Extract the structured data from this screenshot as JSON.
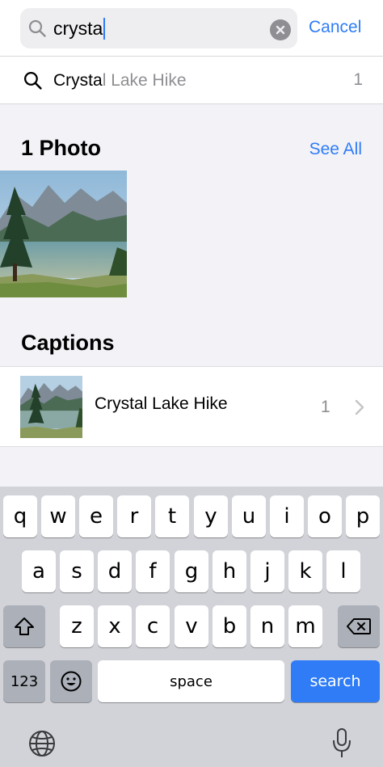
{
  "search": {
    "query": "crysta",
    "cancel_label": "Cancel"
  },
  "suggestion": {
    "match_text": "Crysta",
    "rest_text": "l Lake Hike",
    "count": "1"
  },
  "photos_section": {
    "title": "1 Photo",
    "see_all_label": "See All"
  },
  "captions_section": {
    "title": "Captions",
    "item_label": "Crystal Lake Hike",
    "item_count": "1"
  },
  "keyboard": {
    "row1": [
      "q",
      "w",
      "e",
      "r",
      "t",
      "y",
      "u",
      "i",
      "o",
      "p"
    ],
    "row2": [
      "a",
      "s",
      "d",
      "f",
      "g",
      "h",
      "j",
      "k",
      "l"
    ],
    "row3": [
      "z",
      "x",
      "c",
      "v",
      "b",
      "n",
      "m"
    ],
    "numbers_label": "123",
    "space_label": "space",
    "search_label": "search",
    "icons": [
      "shift-icon",
      "delete-icon",
      "emoji-icon",
      "globe-icon",
      "microphone-icon"
    ]
  },
  "colors": {
    "accent": "#2f7cf6",
    "secondary_text": "#8e8e93",
    "background": "#f2f2f7",
    "keyboard_bg": "#d1d3d9"
  }
}
